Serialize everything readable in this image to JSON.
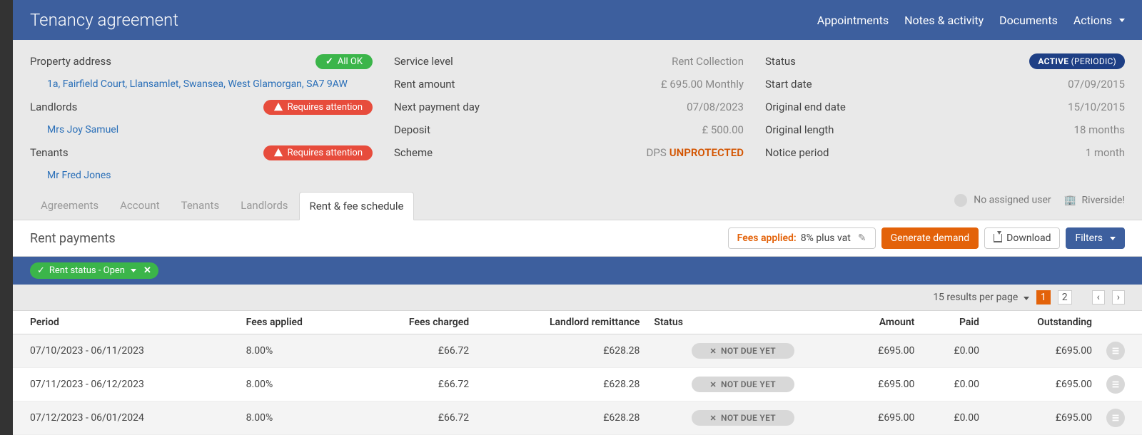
{
  "header": {
    "title": "Tenancy agreement",
    "nav": {
      "appointments": "Appointments",
      "notes": "Notes & activity",
      "documents": "Documents",
      "actions": "Actions"
    }
  },
  "summary": {
    "left": {
      "property_label": "Property address",
      "property_value": "1a, Fairfield Court, Llansamlet, Swansea, West Glamorgan, SA7 9AW",
      "landlords_label": "Landlords",
      "landlord_name": "Mrs Joy Samuel",
      "tenants_label": "Tenants",
      "tenant_name": "Mr Fred Jones",
      "all_ok_badge": "All OK",
      "attention_badge": "Requires attention"
    },
    "mid": {
      "service_level_label": "Service level",
      "service_level_value": "Rent Collection",
      "rent_amount_label": "Rent amount",
      "rent_amount_value": "£ 695.00 Monthly",
      "next_payment_label": "Next payment day",
      "next_payment_value": "07/08/2023",
      "deposit_label": "Deposit",
      "deposit_value": "£ 500.00",
      "scheme_label": "Scheme",
      "scheme_prefix": "DPS",
      "scheme_value": "UNPROTECTED"
    },
    "right": {
      "status_label": "Status",
      "status_value": "ACTIVE",
      "status_paren": "(PERIODIC)",
      "start_date_label": "Start date",
      "start_date_value": "07/09/2015",
      "original_end_label": "Original end date",
      "original_end_value": "15/10/2015",
      "original_length_label": "Original length",
      "original_length_value": "18 months",
      "notice_label": "Notice period",
      "notice_value": "1 month"
    }
  },
  "topright": {
    "user": "No assigned user",
    "office": "Riverside!"
  },
  "tabs": {
    "agreements": "Agreements",
    "account": "Account",
    "tenants": "Tenants",
    "landlords": "Landlords",
    "schedule": "Rent & fee schedule"
  },
  "panel": {
    "title": "Rent payments",
    "fees_label": "Fees applied:",
    "fees_value": "8% plus vat",
    "generate": "Generate demand",
    "download": "Download",
    "filters": "Filters"
  },
  "chip": {
    "text": "Rent status - Open"
  },
  "pagebar": {
    "results": "15 results per page",
    "p1": "1",
    "p2": "2"
  },
  "table": {
    "headers": {
      "period": "Period",
      "fees_applied": "Fees applied",
      "fees_charged": "Fees charged",
      "remittance": "Landlord remittance",
      "status": "Status",
      "amount": "Amount",
      "paid": "Paid",
      "outstanding": "Outstanding"
    },
    "rows": [
      {
        "period": "07/10/2023 - 06/11/2023",
        "fees_applied": "8.00%",
        "fees_charged": "£66.72",
        "remittance": "£628.28",
        "status": "NOT DUE YET",
        "amount": "£695.00",
        "paid": "£0.00",
        "outstanding": "£695.00"
      },
      {
        "period": "07/11/2023 - 06/12/2023",
        "fees_applied": "8.00%",
        "fees_charged": "£66.72",
        "remittance": "£628.28",
        "status": "NOT DUE YET",
        "amount": "£695.00",
        "paid": "£0.00",
        "outstanding": "£695.00"
      },
      {
        "period": "07/12/2023 - 06/01/2024",
        "fees_applied": "8.00%",
        "fees_charged": "£66.72",
        "remittance": "£628.28",
        "status": "NOT DUE YET",
        "amount": "£695.00",
        "paid": "£0.00",
        "outstanding": "£695.00"
      }
    ]
  }
}
